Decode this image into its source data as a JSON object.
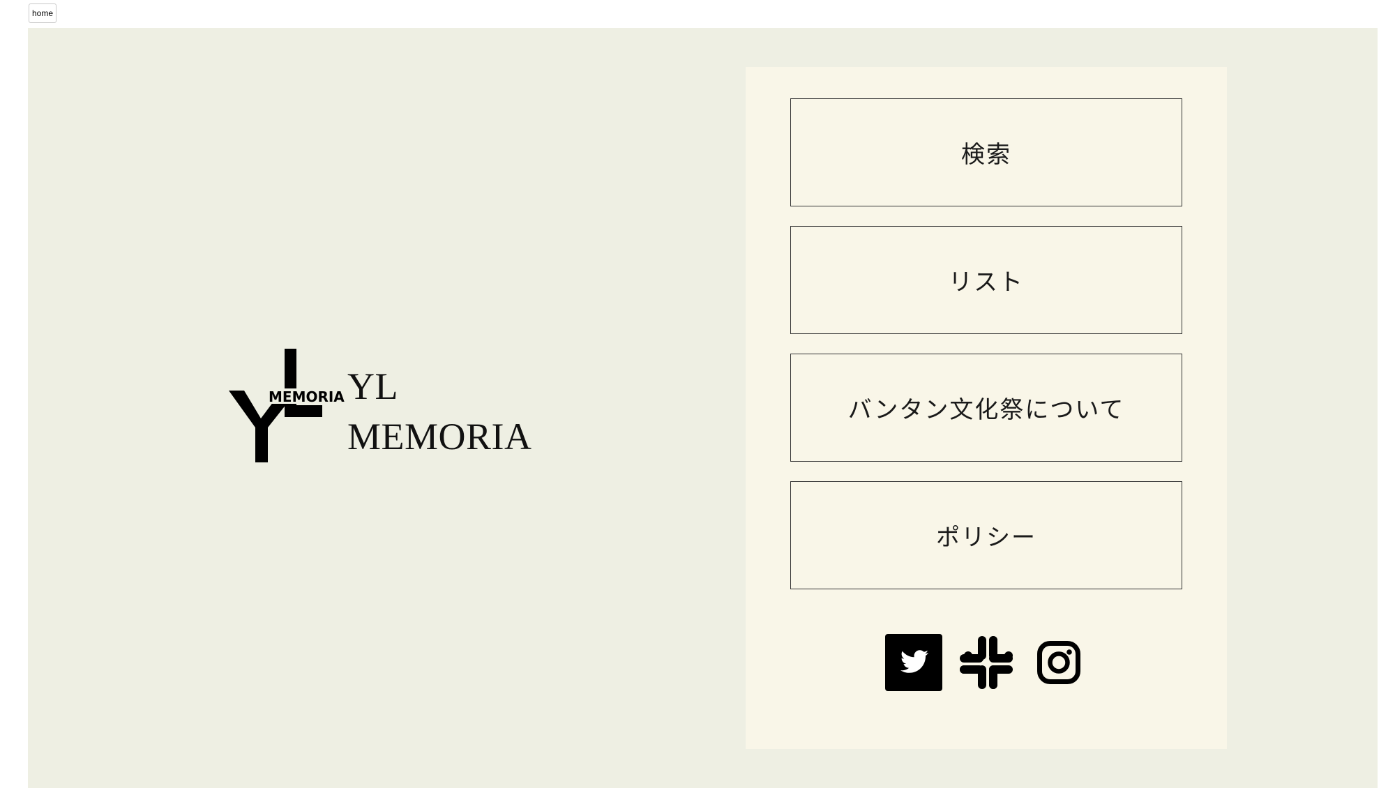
{
  "header": {
    "home_label": "home"
  },
  "brand": {
    "logo_text": "MEMORIA",
    "line1": "YL",
    "line2": "MEMORIA"
  },
  "nav": {
    "items": [
      {
        "label": "検索"
      },
      {
        "label": "リスト"
      },
      {
        "label": "バンタン文化祭について"
      },
      {
        "label": "ポリシー"
      }
    ]
  },
  "socials": [
    {
      "icon": "twitter-icon"
    },
    {
      "icon": "slack-icon"
    },
    {
      "icon": "instagram-icon"
    }
  ],
  "colors": {
    "background": "#eeefe3",
    "panel": "#f9f6e8",
    "ink": "#000000"
  }
}
